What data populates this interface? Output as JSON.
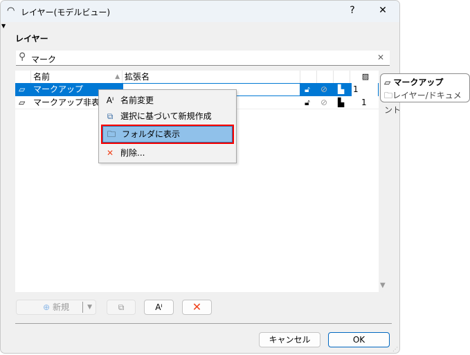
{
  "window": {
    "title": "レイヤー(モデルビュー)",
    "help": "?",
    "close": "✕"
  },
  "section_title": "レイヤー",
  "search": {
    "value": "マーク",
    "clear": "✕"
  },
  "table": {
    "headers": {
      "name": "名前",
      "ext": "拡張名"
    },
    "rows": [
      {
        "name": "マークアップ",
        "ext": "",
        "pen": "1",
        "selected": true
      },
      {
        "name": "マークアップ非表示",
        "ext": "",
        "pen": "1",
        "selected": false
      }
    ]
  },
  "context_menu": {
    "items": [
      {
        "label": "名前変更",
        "icon": "rename-icon"
      },
      {
        "label": "選択に基づいて新規作成",
        "icon": "duplicate-icon"
      },
      {
        "label": "フォルダに表示",
        "icon": "folder-icon",
        "highlighted": true
      },
      {
        "label": "削除...",
        "icon": "delete-icon"
      }
    ]
  },
  "tooltip": {
    "layer": "マークアップ",
    "folder": "レイヤー/ドキュメント"
  },
  "toolbar": {
    "new": "新規"
  },
  "footer": {
    "cancel": "キャンセル",
    "ok": "OK"
  },
  "colors": {
    "selection": "#0078d4",
    "highlight": "#90c1ea",
    "highlight_border": "#ff0000",
    "delete": "#f0431c"
  }
}
